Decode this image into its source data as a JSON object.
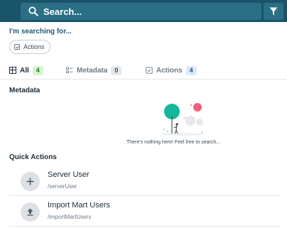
{
  "search": {
    "placeholder": "Search..."
  },
  "searching_for_label": "I'm searching for...",
  "chips": [
    {
      "label": "Actions"
    }
  ],
  "tabs": [
    {
      "label": "All",
      "count": "4",
      "active": true
    },
    {
      "label": "Metadata",
      "count": "0",
      "active": false
    },
    {
      "label": "Actions",
      "count": "4",
      "active": false
    }
  ],
  "metadata_section": {
    "title": "Metadata",
    "empty_text": "There's nothing here! Feel free to search..."
  },
  "quick_actions": {
    "title": "Quick Actions",
    "items": [
      {
        "name": "Server User",
        "path": "/serverUser",
        "icon": "plus-icon"
      },
      {
        "name": "Import Mart Users",
        "path": "/importMartUsers",
        "icon": "upload-icon"
      }
    ]
  },
  "colors": {
    "topbar": "#19546a",
    "search_field": "#2b6f84",
    "badge_green": "#d7f6cf",
    "badge_blue": "#dce9f9",
    "illustration_teal": "#14b79a",
    "illustration_pink": "#f0607a"
  }
}
